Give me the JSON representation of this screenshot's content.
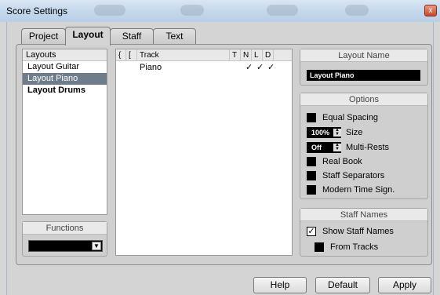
{
  "window": {
    "title": "Score Settings",
    "close_glyph": "x"
  },
  "tabs": [
    {
      "label": "Project"
    },
    {
      "label": "Layout"
    },
    {
      "label": "Staff"
    },
    {
      "label": "Text"
    }
  ],
  "layouts": {
    "header": "Layouts",
    "items": [
      "Layout Guitar",
      "Layout Piano",
      "Layout Drums"
    ],
    "selected": "Layout Piano"
  },
  "functions": {
    "title": "Functions",
    "value": ""
  },
  "tracks": {
    "headers": {
      "brace": "{",
      "bracket": "[",
      "track": "Track",
      "t": "T",
      "n": "N",
      "l": "L",
      "d": "D"
    },
    "rows": [
      {
        "name": "Piano",
        "t": "",
        "n": "✓",
        "l": "✓",
        "d": "✓"
      }
    ]
  },
  "layout_name": {
    "title": "Layout Name",
    "value": "Layout Piano"
  },
  "options": {
    "title": "Options",
    "equal_spacing": "Equal Spacing",
    "size_value": "100%",
    "size_label": "Size",
    "multirests_value": "Off",
    "multirests_label": "Multi-Rests",
    "real_book": "Real Book",
    "staff_separators": "Staff Separators",
    "modern_time": "Modern Time Sign."
  },
  "staff_names": {
    "title": "Staff Names",
    "show_label": "Show Staff Names",
    "show_checked": true,
    "from_tracks_label": "From Tracks",
    "check_glyph": "✓"
  },
  "buttons": {
    "help": "Help",
    "default": "Default",
    "apply": "Apply"
  }
}
